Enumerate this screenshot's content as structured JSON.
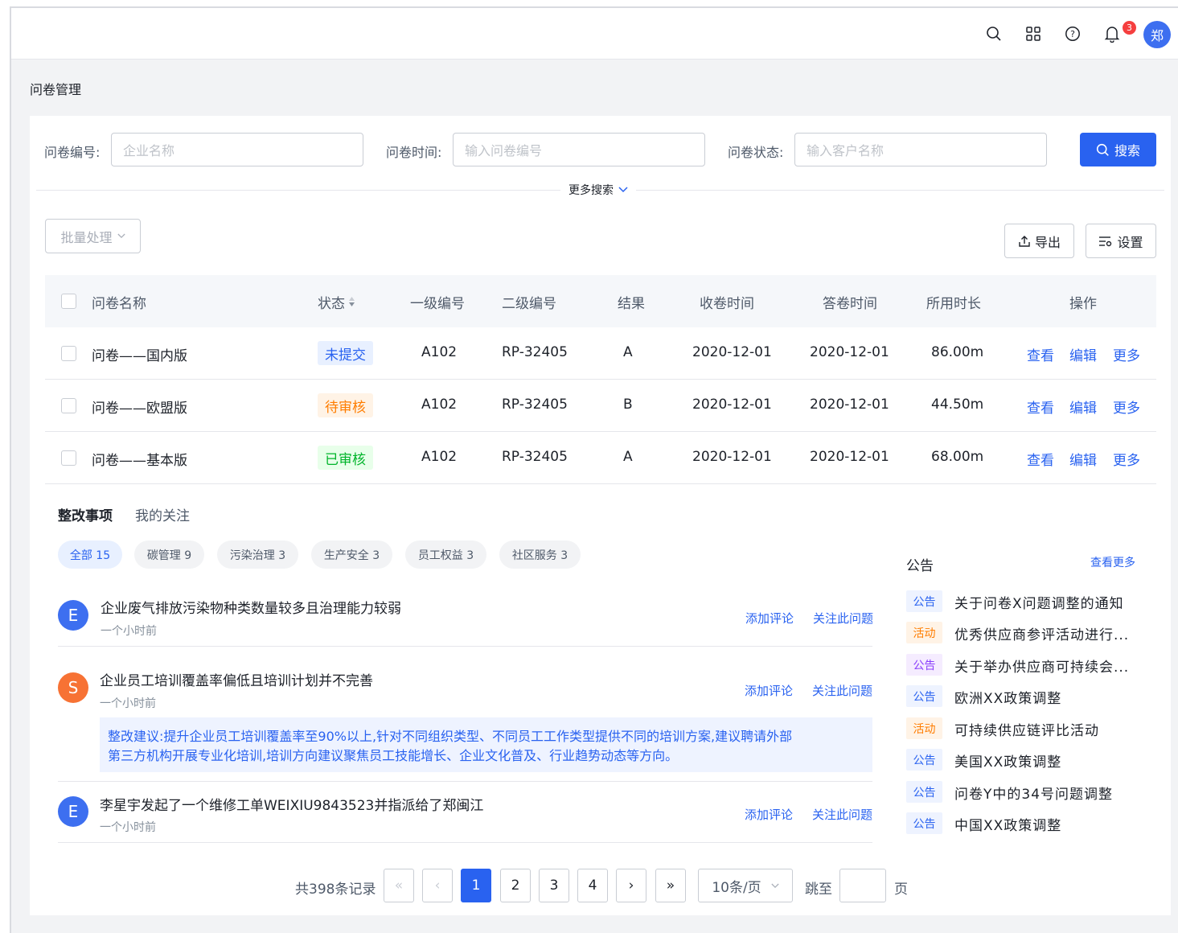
{
  "header": {
    "icons": [
      "search-icon",
      "apps-grid-icon",
      "help-icon",
      "bell-icon"
    ],
    "notification_count": "3",
    "avatar_text": "郑"
  },
  "page_title": "问卷管理",
  "search": {
    "field1_label": "问卷编号:",
    "field1_placeholder": "企业名称",
    "field2_label": "问卷时间:",
    "field2_placeholder": "输入问卷编号",
    "field3_label": "问卷状态:",
    "field3_placeholder": "输入客户名称",
    "search_button": "搜索",
    "more_search": "更多搜索"
  },
  "toolbar": {
    "batch_label": "批量处理",
    "export_label": "导出",
    "settings_label": "设置"
  },
  "table": {
    "headers": [
      "问卷名称",
      "状态",
      "一级编号",
      "二级编号",
      "结果",
      "收卷时间",
      "答卷时间",
      "所用时长",
      "操作"
    ],
    "rows": [
      {
        "name": "问卷——国内版",
        "status": "未提交",
        "level1": "A102",
        "level2": "RP-32405",
        "result": "A",
        "receive": "2020-12-01",
        "answer": "2020-12-01",
        "duration": "86.00m"
      },
      {
        "name": "问卷——欧盟版",
        "status": "待审核",
        "level1": "A102",
        "level2": "RP-32405",
        "result": "B",
        "receive": "2020-12-01",
        "answer": "2020-12-01",
        "duration": "44.50m"
      },
      {
        "name": "问卷——基本版",
        "status": "已审核",
        "level1": "A102",
        "level2": "RP-32405",
        "result": "A",
        "receive": "2020-12-01",
        "answer": "2020-12-01",
        "duration": "68.00m"
      }
    ],
    "actions": {
      "view": "查看",
      "edit": "编辑",
      "more": "更多"
    }
  },
  "feed": {
    "tabs": [
      "整改事项",
      "我的关注"
    ],
    "chips": [
      "全部 15",
      "碳管理 9",
      "污染治理 3",
      "生产安全 3",
      "员工权益 3",
      "社区服务 3"
    ],
    "items": [
      {
        "avatar": "E",
        "title": "企业废气排放污染物种类数量较多且治理能力较弱",
        "time": "一个小时前"
      },
      {
        "avatar": "S",
        "title": "企业员工培训覆盖率偏低且培训计划并不完善",
        "time": "一个小时前"
      },
      {
        "avatar": "E",
        "title": "李星宇发起了一个维修工单WEIXIU9843523并指派给了郑闽江",
        "time": "一个小时前"
      }
    ],
    "suggestion_line1": "整改建议:提升企业员工培训覆盖率至90%以上,针对不同组织类型、不同员工工作类型提供不同的培训方案,建议聘请外部",
    "suggestion_line2": "第三方机构开展专业化培训,培训方向建议聚焦员工技能增长、企业文化普及、行业趋势动态等方向。",
    "add_comment": "添加评论",
    "follow": "关注此问题"
  },
  "announcements": {
    "title": "公告",
    "more": "查看更多",
    "items": [
      {
        "tag": "公告",
        "text": "关于问卷X问题调整的通知"
      },
      {
        "tag": "活动",
        "text": "优秀供应商参评活动进行..."
      },
      {
        "tag": "公告",
        "text": "关于举办供应商可持续会..."
      },
      {
        "tag": "公告",
        "text": "欧洲XX政策调整"
      },
      {
        "tag": "活动",
        "text": "可持续供应链评比活动"
      },
      {
        "tag": "公告",
        "text": "美国XX政策调整"
      },
      {
        "tag": "公告",
        "text": "问卷Y中的34号问题调整"
      },
      {
        "tag": "公告",
        "text": "中国XX政策调整"
      }
    ]
  },
  "pagination": {
    "total": "共398条记录",
    "pages": [
      "1",
      "2",
      "3",
      "4"
    ],
    "current": "1",
    "page_size": "10条/页",
    "jump_label": "跳至",
    "page_unit": "页"
  }
}
